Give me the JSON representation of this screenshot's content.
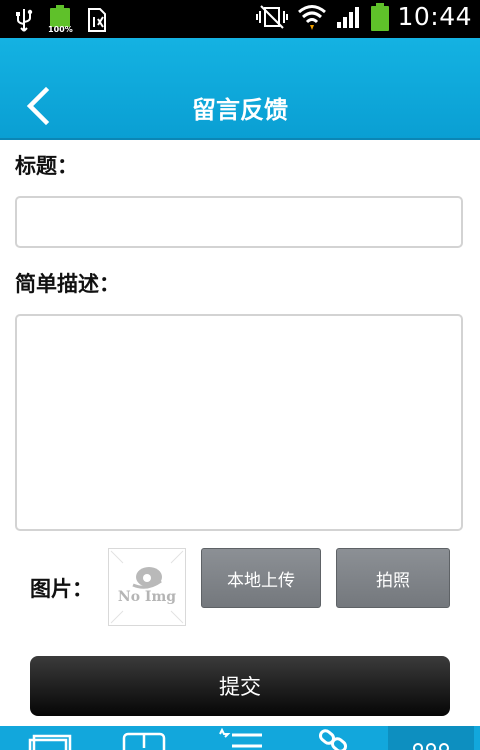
{
  "status_bar": {
    "time": "10:44",
    "battery_label": "100%",
    "icons": [
      "usb-icon",
      "battery-full-icon",
      "sim-icon",
      "nfc-vibrate-icon",
      "wifi-icon",
      "signal-icon",
      "battery-icon"
    ]
  },
  "header": {
    "title": "留言反馈",
    "back_icon": "chevron-left-icon"
  },
  "form": {
    "title_label": "标题：",
    "title_value": "",
    "description_label": "简单描述：",
    "description_value": "",
    "image_label": "图片：",
    "image_placeholder_text": "No Img",
    "upload_local_label": "本地上传",
    "take_photo_label": "拍照",
    "submit_label": "提交"
  },
  "bottom_nav": {
    "icons": [
      "cards-icon",
      "download-icon",
      "list-star-icon",
      "link-icon",
      "more-icon"
    ]
  },
  "colors": {
    "header": "#0fa8dd",
    "status_bar": "#000000",
    "button_gray": "#7f8388",
    "submit": "#1a1a1a",
    "bottom_bar": "#12a7dc"
  }
}
